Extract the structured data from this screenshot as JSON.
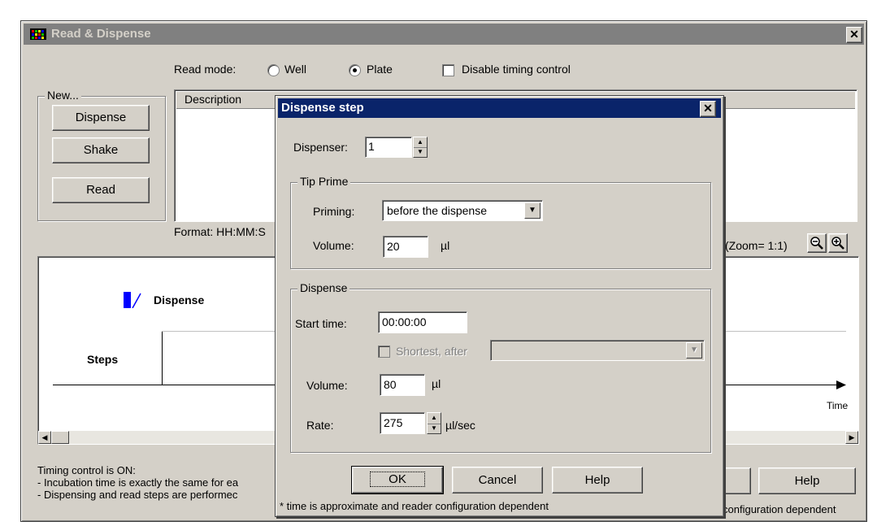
{
  "main_window": {
    "title": "Read & Dispense",
    "read_mode_label": "Read mode:",
    "radio_well": "Well",
    "radio_plate": "Plate",
    "disable_timing_label": "Disable timing control",
    "new_group_label": "New...",
    "btn_dispense": "Dispense",
    "btn_shake": "Shake",
    "btn_read": "Read",
    "table_header_description": "Description",
    "format_text": "Format: HH:MM:S",
    "zoom_text": "(Zoom= 1:1)",
    "timeline_dispense": "Dispense",
    "timeline_steps": "Steps",
    "timeline_time": "Time",
    "status_line1": "Timing control is ON:",
    "status_line2": "- Incubation time is exactly the same for ea",
    "status_line3": "- Dispensing and read steps are performec",
    "bottom_help": "Help",
    "bottom_note": "configuration dependent"
  },
  "dialog": {
    "title": "Dispense step",
    "dispenser_label": "Dispenser:",
    "dispenser_value": "1",
    "tip_prime_group": "Tip Prime",
    "priming_label": "Priming:",
    "priming_value": "before the dispense",
    "tp_volume_label": "Volume:",
    "tp_volume_value": "20",
    "tp_volume_unit": "µl",
    "dispense_group": "Dispense",
    "start_time_label": "Start time:",
    "start_time_value": "00:00:00",
    "shortest_after_label": "Shortest, after",
    "d_volume_label": "Volume:",
    "d_volume_value": "80",
    "d_volume_unit": "µl",
    "rate_label": "Rate:",
    "rate_value": "275",
    "rate_unit": "µl/sec",
    "ok": "OK",
    "cancel": "Cancel",
    "help": "Help",
    "footnote": "* time is approximate and reader configuration dependent"
  }
}
